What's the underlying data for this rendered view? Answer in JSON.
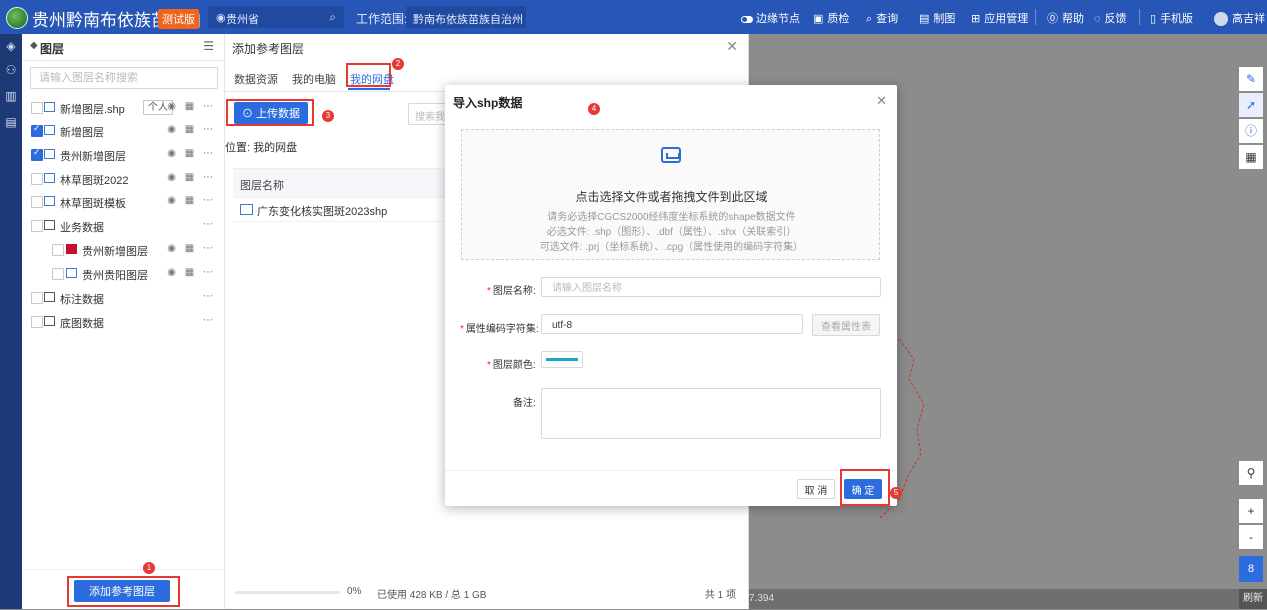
{
  "topbar": {
    "app_title": "贵州黔南布依族苗族自",
    "env_badge": "测试版",
    "region": "贵州省",
    "scope_label": "工作范围:",
    "scope_value": "黔南布依族苗族自治州",
    "nav": {
      "edge_node": "边缘节点",
      "quality": "质检",
      "query": "查询",
      "mapping": "制图",
      "app_manage": "应用管理",
      "help": "帮助",
      "feedback": "反馈",
      "mobile": "手机版",
      "user": "高吉祥"
    }
  },
  "layers_panel": {
    "title": "图层",
    "search_placeholder": "请输入图层名称搜索",
    "personal_tag": "个人",
    "layers": [
      {
        "name": "新增图层.shp",
        "checked": false,
        "icon": "polygon"
      },
      {
        "name": "新增图层",
        "checked": true,
        "icon": "polygon"
      },
      {
        "name": "贵州新增图层",
        "checked": true,
        "icon": "polygon"
      },
      {
        "name": "林草图斑2022",
        "checked": false,
        "icon": "polygon"
      },
      {
        "name": "林草图斑模板",
        "checked": false,
        "icon": "polygon"
      },
      {
        "name": "业务数据",
        "checked": false,
        "icon": "folder"
      },
      {
        "name": "贵州新增图层",
        "checked": false,
        "icon": "red-fill"
      },
      {
        "name": "贵州贵阳图层",
        "checked": false,
        "icon": "polygon"
      },
      {
        "name": "标注数据",
        "checked": false,
        "icon": "folder"
      },
      {
        "name": "底图数据",
        "checked": false,
        "icon": "folder"
      }
    ],
    "add_ref_button": "添加参考图层"
  },
  "add_ref_panel": {
    "title": "添加参考图层",
    "tabs": [
      "数据资源",
      "我的电脑",
      "我的网盘"
    ],
    "active_tab": "我的网盘",
    "upload_button": "上传数据",
    "search_placeholder": "搜索我",
    "location": "位置: 我的网盘",
    "table_header": "图层名称",
    "rows": [
      "广东变化核实图斑2023shp"
    ],
    "progress_percent": "0%",
    "usage": "已使用 428 KB / 总 1 GB",
    "total_items": "共 1 项"
  },
  "modal": {
    "title": "导入shp数据",
    "drop_main": "点击选择文件或者拖拽文件到此区域",
    "drop_line1": "请务必选择CGCS2000经纬度坐标系统的shape数据文件",
    "drop_line2": "必选文件: .shp（图形）、.dbf（属性）、.shx（关联索引）",
    "drop_line3": "可选文件: .prj（坐标系统）、.cpg（属性使用的编码字符集）",
    "name_label": "图层名称:",
    "name_placeholder": "请输入图层名称",
    "charset_label": "属性编码字符集:",
    "charset_value": "utf-8",
    "view_attr_button": "查看属性表",
    "color_label": "图层颜色:",
    "layer_color": "#1aa8c9",
    "remark_label": "备注:",
    "cancel_button": "取 消",
    "ok_button": "确 定"
  },
  "map": {
    "coords": "7.394",
    "refresh": "刷新",
    "zoom_level": "8",
    "zoom_in": "+",
    "zoom_out": "-"
  },
  "annotations": [
    "1",
    "2",
    "3",
    "4",
    "5"
  ]
}
